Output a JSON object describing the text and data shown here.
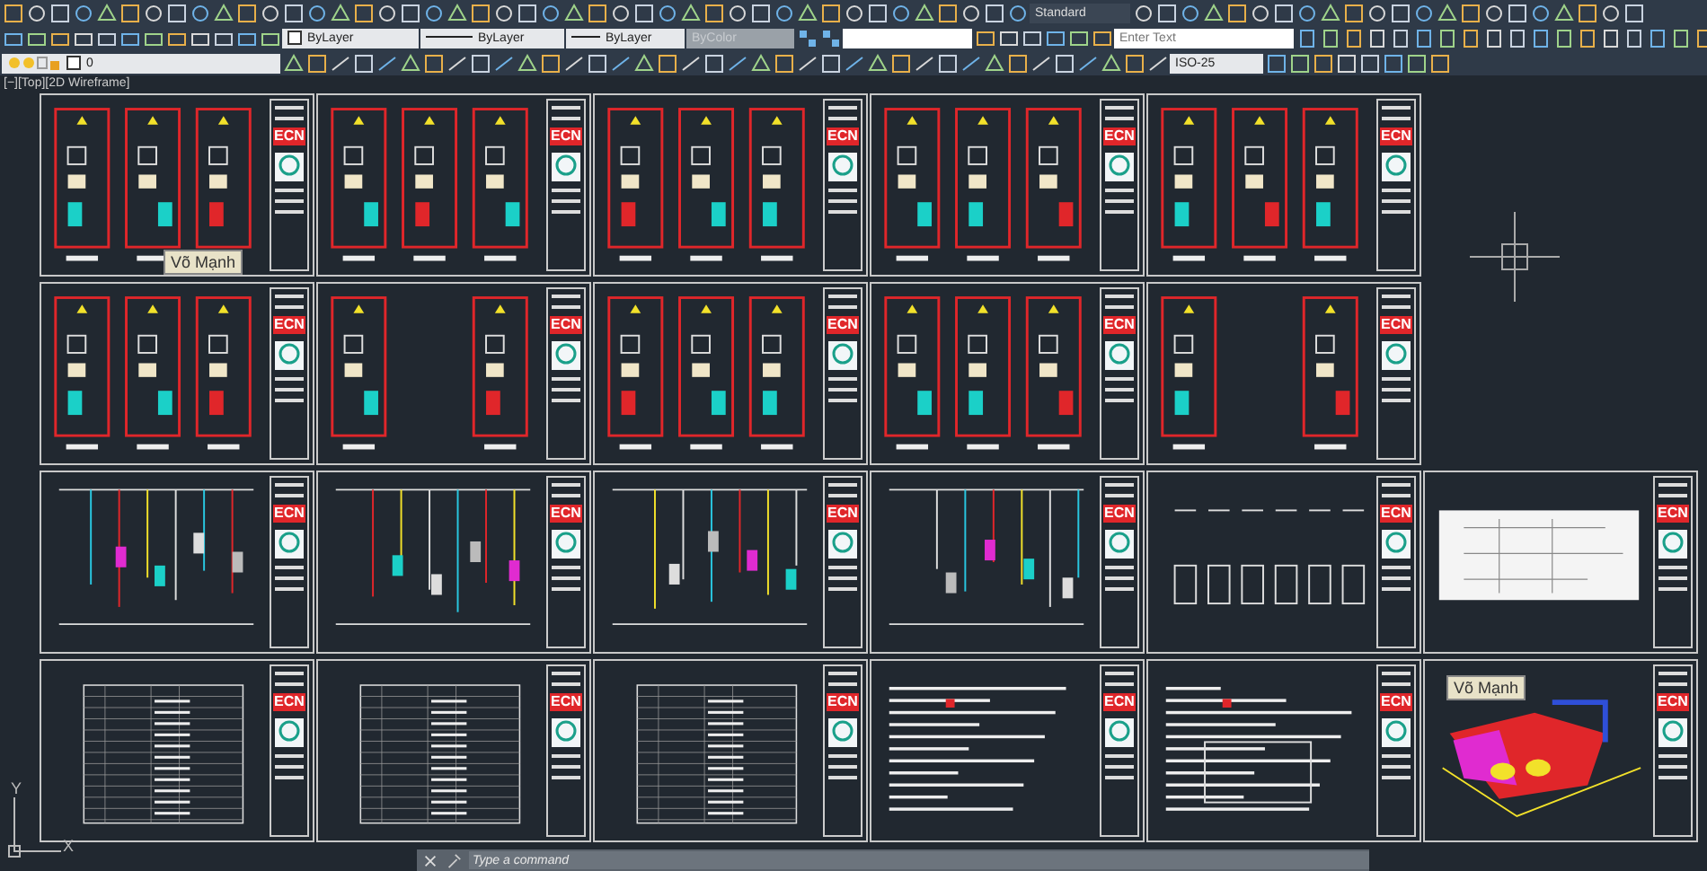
{
  "toolbar": {
    "text_style": "Standard",
    "layer_color": "ByLayer",
    "linetype": "ByLayer",
    "lineweight": "ByLayer",
    "plot_style": {
      "value": "ByColor",
      "disabled": true
    },
    "search": {
      "placeholder": "Enter Text"
    },
    "layer": "0",
    "dim_style": "ISO-25"
  },
  "viewport": {
    "label": "[−][Top][2D Wireframe]"
  },
  "sheet_rows": [
    {
      "sheets": [
        {
          "kind": "cabinets",
          "title_block": "ECN",
          "tooltip": "Võ Mạnh"
        },
        {
          "kind": "cabinets",
          "title_block": "ECN"
        },
        {
          "kind": "cabinets",
          "title_block": "ECN"
        },
        {
          "kind": "cabinets",
          "title_block": "ECN"
        },
        {
          "kind": "cabinets",
          "title_block": "ECN"
        }
      ]
    },
    {
      "sheets": [
        {
          "kind": "cabinets",
          "title_block": "ECN"
        },
        {
          "kind": "cabinets",
          "title_block": "ECN"
        },
        {
          "kind": "cabinets",
          "title_block": "ECN"
        },
        {
          "kind": "cabinets",
          "title_block": "ECN"
        },
        {
          "kind": "cabinets",
          "title_block": "ECN"
        }
      ]
    },
    {
      "sheets": [
        {
          "kind": "schematic",
          "title_block": "ECN"
        },
        {
          "kind": "schematic",
          "title_block": "ECN"
        },
        {
          "kind": "schematic",
          "title_block": "ECN"
        },
        {
          "kind": "schematic",
          "title_block": "ECN"
        },
        {
          "kind": "layout",
          "title_block": "ECN"
        },
        {
          "kind": "diagram",
          "title_block": "ECN"
        }
      ]
    },
    {
      "sheets": [
        {
          "kind": "table",
          "title_block": "ECN"
        },
        {
          "kind": "table",
          "title_block": "ECN"
        },
        {
          "kind": "table",
          "title_block": "ECN"
        },
        {
          "kind": "notes",
          "title_block": "ECN"
        },
        {
          "kind": "notes",
          "title_block": "ECN"
        },
        {
          "kind": "model",
          "title_block": "ECN",
          "tooltip": "Võ Mạnh"
        }
      ]
    }
  ],
  "ucs": {
    "y_label": "Y",
    "x_label": "X"
  },
  "command_line": {
    "placeholder": "Type a command"
  }
}
